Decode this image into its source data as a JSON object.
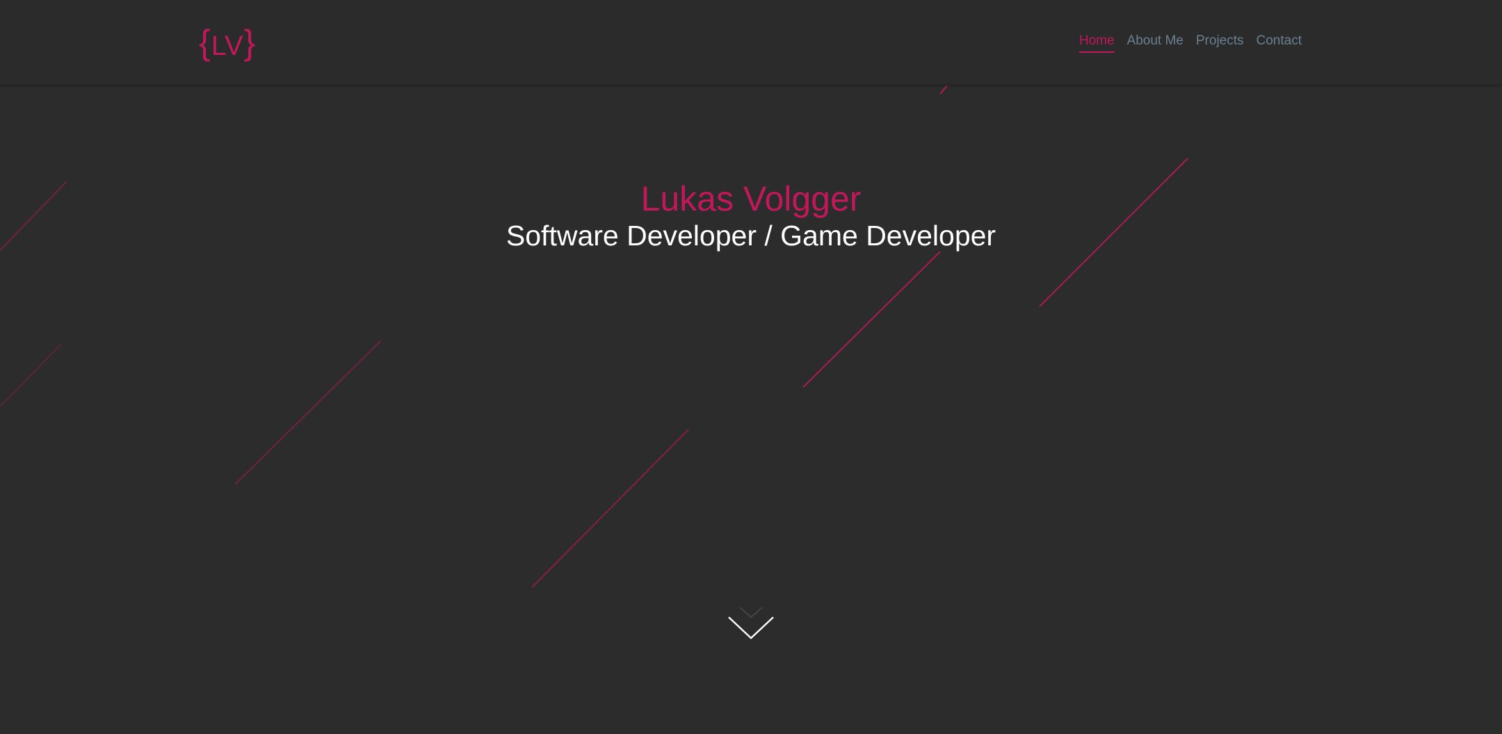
{
  "logo": {
    "open_brace": "{",
    "letters": "LV",
    "close_brace": "}"
  },
  "nav": {
    "items": [
      {
        "label": "Home",
        "active": true
      },
      {
        "label": "About Me",
        "active": false
      },
      {
        "label": "Projects",
        "active": false
      },
      {
        "label": "Contact",
        "active": false
      }
    ]
  },
  "hero": {
    "name": "Lukas Volgger",
    "role": "Software Developer / Game Developer"
  },
  "icons": {
    "scroll_down": "chevron-down-icon"
  },
  "colors": {
    "background": "#2c2c2c",
    "accent": "#c2185b",
    "nav_text": "#6b8191",
    "hero_role": "#ffffff"
  }
}
